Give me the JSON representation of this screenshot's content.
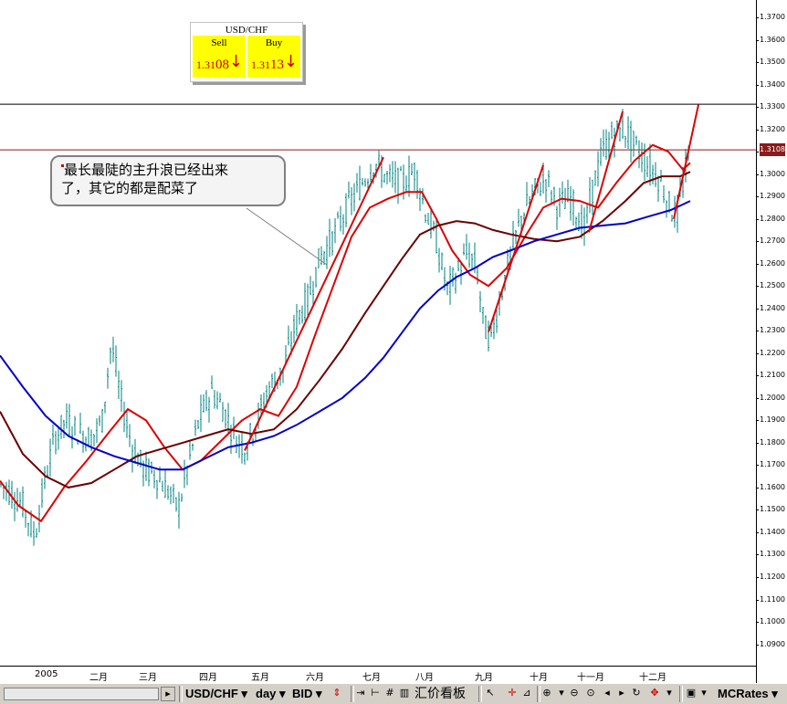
{
  "quote": {
    "symbol": "USD/CHF",
    "sell_label": "Sell",
    "buy_label": "Buy",
    "sell_price_prefix": "1.31",
    "sell_price_suffix": "08",
    "buy_price_prefix": "1.31",
    "buy_price_suffix": "13",
    "direction_glyph": "↓"
  },
  "annotation": {
    "line1": "最长最陡的主升浪已经出来",
    "line2": "了，其它的都是配菜了"
  },
  "current_price_badge": "1.3108",
  "colors": {
    "candles": "#008080",
    "ma_fast": "#dd0000",
    "ma_mid": "#6b0000",
    "ma_slow": "#0000cc",
    "trend_lines": "#dd0000",
    "hline_resistance": "#000000",
    "hline_price": "#8b1a1a",
    "badge": "#8b1a1a",
    "quote_bg": "#ffff00"
  },
  "chart_data": {
    "type": "line",
    "instrument": "USD/CHF",
    "timeframe": "day",
    "ylim": [
      1.085,
      1.378
    ],
    "y_ticks": [
      "1.3700",
      "1.3600",
      "1.3500",
      "1.3400",
      "1.3300",
      "1.3200",
      "1.3100",
      "1.3000",
      "1.2900",
      "1.2800",
      "1.2700",
      "1.2600",
      "1.2500",
      "1.2400",
      "1.2300",
      "1.2200",
      "1.2100",
      "1.2000",
      "1.1900",
      "1.1800",
      "1.1700",
      "1.1600",
      "1.1500",
      "1.1400",
      "1.1300",
      "1.1200",
      "1.1100",
      "1.1000",
      "1.0900"
    ],
    "x_labels": [
      "2005",
      "二月",
      "三月",
      "四月",
      "五月",
      "六月",
      "七月",
      "八月",
      "九月",
      "十月",
      "十一月",
      "十二月"
    ],
    "horizontal_lines": [
      1.3312,
      1.3108
    ],
    "price_path": [
      [
        0,
        1.162
      ],
      [
        12,
        1.158
      ],
      [
        25,
        1.152
      ],
      [
        38,
        1.138
      ],
      [
        50,
        1.165
      ],
      [
        60,
        1.182
      ],
      [
        72,
        1.19
      ],
      [
        85,
        1.185
      ],
      [
        100,
        1.182
      ],
      [
        112,
        1.19
      ],
      [
        122,
        1.225
      ],
      [
        132,
        1.2
      ],
      [
        145,
        1.178
      ],
      [
        158,
        1.168
      ],
      [
        172,
        1.165
      ],
      [
        185,
        1.158
      ],
      [
        195,
        1.15
      ],
      [
        205,
        1.168
      ],
      [
        218,
        1.19
      ],
      [
        232,
        1.203
      ],
      [
        245,
        1.195
      ],
      [
        258,
        1.182
      ],
      [
        268,
        1.178
      ],
      [
        280,
        1.188
      ],
      [
        295,
        1.205
      ],
      [
        310,
        1.212
      ],
      [
        325,
        1.235
      ],
      [
        338,
        1.245
      ],
      [
        350,
        1.262
      ],
      [
        365,
        1.272
      ],
      [
        380,
        1.285
      ],
      [
        395,
        1.295
      ],
      [
        410,
        1.305
      ],
      [
        425,
        1.298
      ],
      [
        440,
        1.296
      ],
      [
        455,
        1.302
      ],
      [
        465,
        1.285
      ],
      [
        478,
        1.27
      ],
      [
        490,
        1.248
      ],
      [
        500,
        1.255
      ],
      [
        512,
        1.265
      ],
      [
        522,
        1.258
      ],
      [
        530,
        1.232
      ],
      [
        538,
        1.226
      ],
      [
        548,
        1.245
      ],
      [
        560,
        1.265
      ],
      [
        572,
        1.282
      ],
      [
        585,
        1.292
      ],
      [
        598,
        1.298
      ],
      [
        610,
        1.286
      ],
      [
        625,
        1.289
      ],
      [
        640,
        1.275
      ],
      [
        650,
        1.295
      ],
      [
        660,
        1.31
      ],
      [
        672,
        1.318
      ],
      [
        684,
        1.32
      ],
      [
        696,
        1.312
      ],
      [
        710,
        1.304
      ],
      [
        722,
        1.298
      ],
      [
        735,
        1.284
      ],
      [
        742,
        1.282
      ],
      [
        750,
        1.3
      ],
      [
        756,
        1.31
      ]
    ],
    "series": [
      {
        "name": "",
        "color": "#dd0000",
        "points": [
          [
            0,
            1.163
          ],
          [
            20,
            1.152
          ],
          [
            45,
            1.145
          ],
          [
            70,
            1.16
          ],
          [
            95,
            1.172
          ],
          [
            120,
            1.185
          ],
          [
            140,
            1.195
          ],
          [
            160,
            1.19
          ],
          [
            180,
            1.178
          ],
          [
            200,
            1.168
          ],
          [
            220,
            1.172
          ],
          [
            245,
            1.182
          ],
          [
            265,
            1.19
          ],
          [
            285,
            1.195
          ],
          [
            305,
            1.192
          ],
          [
            325,
            1.205
          ],
          [
            345,
            1.228
          ],
          [
            365,
            1.25
          ],
          [
            385,
            1.272
          ],
          [
            405,
            1.285
          ],
          [
            425,
            1.289
          ],
          [
            445,
            1.292
          ],
          [
            462,
            1.292
          ],
          [
            478,
            1.28
          ],
          [
            495,
            1.266
          ],
          [
            515,
            1.255
          ],
          [
            535,
            1.25
          ],
          [
            555,
            1.258
          ],
          [
            575,
            1.272
          ],
          [
            595,
            1.285
          ],
          [
            615,
            1.289
          ],
          [
            635,
            1.288
          ],
          [
            655,
            1.285
          ],
          [
            675,
            1.296
          ],
          [
            695,
            1.306
          ],
          [
            715,
            1.313
          ],
          [
            732,
            1.31
          ],
          [
            748,
            1.302
          ],
          [
            756,
            1.305
          ]
        ]
      },
      {
        "name": "",
        "color": "#6b0000",
        "points": [
          [
            0,
            1.194
          ],
          [
            25,
            1.175
          ],
          [
            50,
            1.165
          ],
          [
            75,
            1.16
          ],
          [
            100,
            1.162
          ],
          [
            125,
            1.168
          ],
          [
            150,
            1.174
          ],
          [
            175,
            1.177
          ],
          [
            200,
            1.18
          ],
          [
            225,
            1.183
          ],
          [
            250,
            1.186
          ],
          [
            275,
            1.184
          ],
          [
            300,
            1.186
          ],
          [
            325,
            1.195
          ],
          [
            350,
            1.208
          ],
          [
            375,
            1.222
          ],
          [
            400,
            1.238
          ],
          [
            420,
            1.25
          ],
          [
            440,
            1.262
          ],
          [
            460,
            1.273
          ],
          [
            480,
            1.277
          ],
          [
            500,
            1.279
          ],
          [
            520,
            1.278
          ],
          [
            540,
            1.275
          ],
          [
            560,
            1.273
          ],
          [
            585,
            1.271
          ],
          [
            610,
            1.27
          ],
          [
            635,
            1.272
          ],
          [
            660,
            1.279
          ],
          [
            685,
            1.288
          ],
          [
            705,
            1.296
          ],
          [
            725,
            1.299
          ],
          [
            745,
            1.299
          ],
          [
            756,
            1.301
          ]
        ]
      },
      {
        "name": "",
        "color": "#0000cc",
        "points": [
          [
            0,
            1.219
          ],
          [
            25,
            1.205
          ],
          [
            50,
            1.192
          ],
          [
            75,
            1.183
          ],
          [
            100,
            1.178
          ],
          [
            125,
            1.174
          ],
          [
            150,
            1.171
          ],
          [
            175,
            1.168
          ],
          [
            200,
            1.168
          ],
          [
            225,
            1.173
          ],
          [
            250,
            1.178
          ],
          [
            275,
            1.18
          ],
          [
            300,
            1.183
          ],
          [
            325,
            1.188
          ],
          [
            350,
            1.194
          ],
          [
            375,
            1.2
          ],
          [
            400,
            1.209
          ],
          [
            420,
            1.218
          ],
          [
            440,
            1.229
          ],
          [
            460,
            1.24
          ],
          [
            480,
            1.248
          ],
          [
            500,
            1.254
          ],
          [
            520,
            1.258
          ],
          [
            540,
            1.263
          ],
          [
            560,
            1.266
          ],
          [
            585,
            1.27
          ],
          [
            610,
            1.273
          ],
          [
            635,
            1.276
          ],
          [
            660,
            1.277
          ],
          [
            685,
            1.278
          ],
          [
            710,
            1.281
          ],
          [
            735,
            1.284
          ],
          [
            756,
            1.288
          ]
        ]
      }
    ],
    "trend_lines": [
      [
        [
          268,
          1.1765
        ],
        [
          420,
          1.3075
        ]
      ],
      [
        [
          535,
          1.2295
        ],
        [
          595,
          1.304
        ]
      ],
      [
        [
          645,
          1.274
        ],
        [
          682,
          1.328
        ]
      ],
      [
        [
          738,
          1.28
        ],
        [
          765,
          1.331
        ]
      ]
    ]
  },
  "toolbar": {
    "symbol": "USD/CHF",
    "timeframe": "day",
    "price_type": "BID",
    "quote_board": "汇价看板",
    "mcrates": "MCRates"
  }
}
